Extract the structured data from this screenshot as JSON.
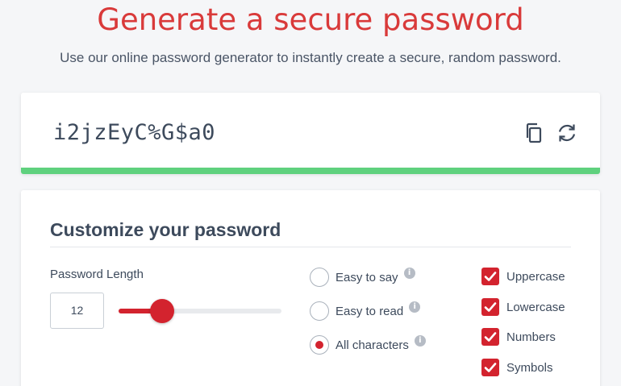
{
  "header": {
    "title": "Generate a secure password",
    "subtitle": "Use our online password generator to instantly create a secure, random password."
  },
  "password": {
    "value": "i2jzEyC%G$a0",
    "copy_icon": "copy-icon",
    "refresh_icon": "refresh-icon",
    "strength_color": "#5fd17e"
  },
  "customize": {
    "title": "Customize your password",
    "length_label": "Password Length",
    "length_value": "12",
    "slider": {
      "min": 1,
      "max": 50,
      "value": 12
    },
    "modes": [
      {
        "label": "Easy to say",
        "selected": false
      },
      {
        "label": "Easy to read",
        "selected": false
      },
      {
        "label": "All characters",
        "selected": true
      }
    ],
    "info_glyph": "i",
    "options": [
      {
        "label": "Uppercase",
        "checked": true
      },
      {
        "label": "Lowercase",
        "checked": true
      },
      {
        "label": "Numbers",
        "checked": true
      },
      {
        "label": "Symbols",
        "checked": true
      }
    ]
  },
  "colors": {
    "accent": "#d3232e",
    "title": "#d93a3a",
    "strength": "#5fd17e"
  }
}
